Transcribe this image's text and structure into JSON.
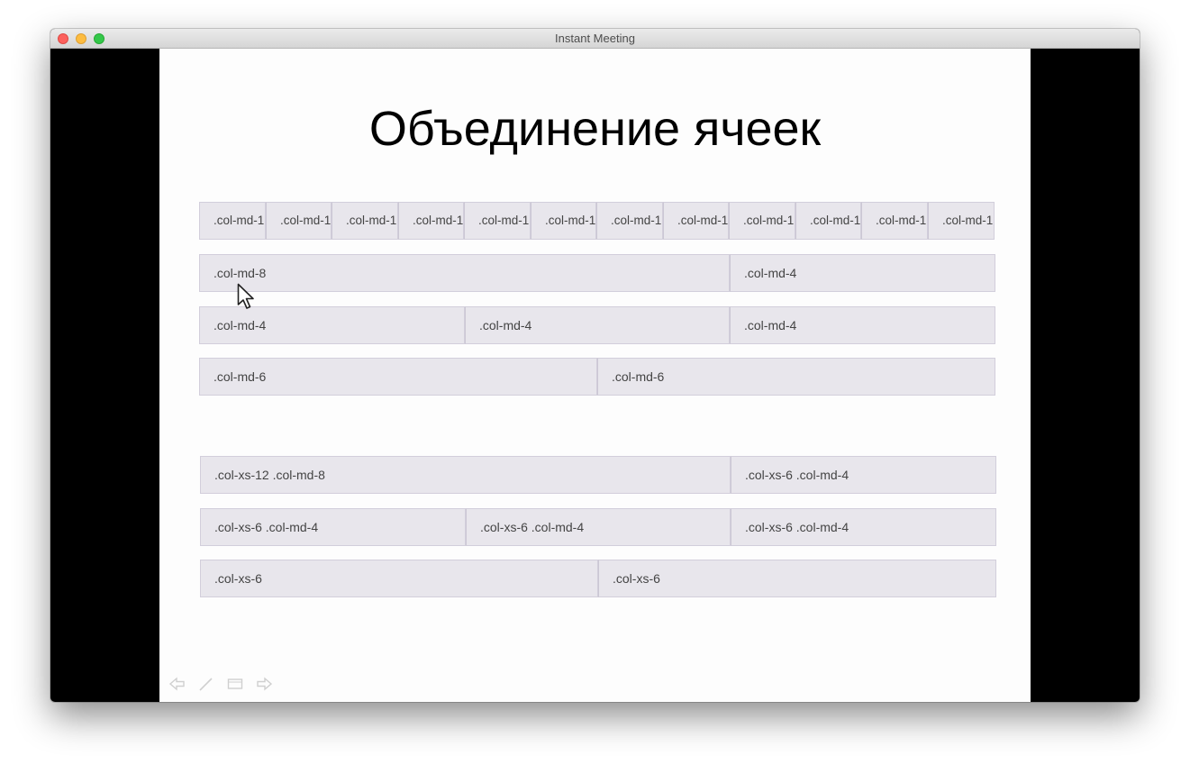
{
  "window": {
    "title": "Instant Meeting"
  },
  "slide": {
    "title": "Объединение ячеек",
    "grid_top": {
      "row1": [
        ".col-md-1",
        ".col-md-1",
        ".col-md-1",
        ".col-md-1",
        ".col-md-1",
        ".col-md-1",
        ".col-md-1",
        ".col-md-1",
        ".col-md-1",
        ".col-md-1",
        ".col-md-1",
        ".col-md-1"
      ],
      "row2": [
        ".col-md-8",
        ".col-md-4"
      ],
      "row3": [
        ".col-md-4",
        ".col-md-4",
        ".col-md-4"
      ],
      "row4": [
        ".col-md-6",
        ".col-md-6"
      ]
    },
    "grid_bottom": {
      "row1": [
        ".col-xs-12 .col-md-8",
        ".col-xs-6 .col-md-4"
      ],
      "row2": [
        ".col-xs-6 .col-md-4",
        ".col-xs-6 .col-md-4",
        ".col-xs-6 .col-md-4"
      ],
      "row3": [
        ".col-xs-6",
        ".col-xs-6"
      ]
    }
  },
  "controls": {
    "icons": [
      "arrow-left-icon",
      "pen-icon",
      "slides-icon",
      "arrow-right-icon"
    ]
  },
  "colors": {
    "cell_background": "#e8e6ec",
    "cell_border": "#d2cedb",
    "slide_background": "#fdfdfd"
  }
}
